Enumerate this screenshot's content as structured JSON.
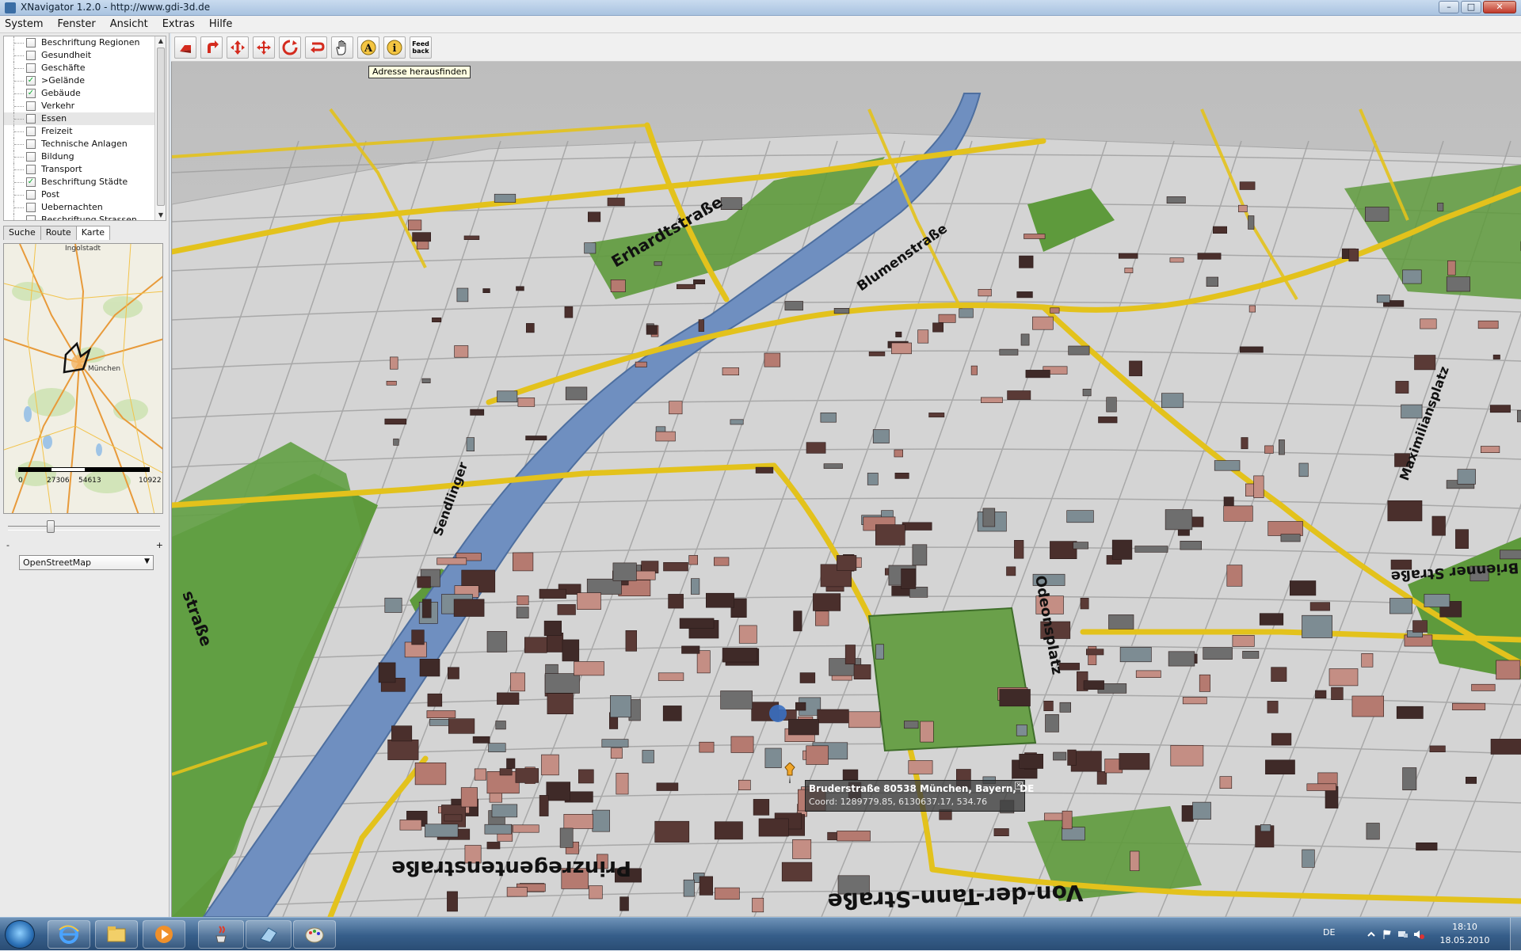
{
  "window": {
    "title": "XNavigator 1.2.0 - http://www.gdi-3d.de",
    "controls": [
      "–",
      "□",
      "✕"
    ]
  },
  "menu": [
    "System",
    "Fenster",
    "Ansicht",
    "Extras",
    "Hilfe"
  ],
  "layers": [
    {
      "label": "Beschriftung Regionen",
      "checked": false
    },
    {
      "label": "Gesundheit",
      "checked": false
    },
    {
      "label": "Geschäfte",
      "checked": false
    },
    {
      "label": ">Gelände",
      "checked": true
    },
    {
      "label": "Gebäude",
      "checked": true
    },
    {
      "label": "Verkehr",
      "checked": false
    },
    {
      "label": "Essen",
      "checked": false,
      "selected": true
    },
    {
      "label": "Freizeit",
      "checked": false
    },
    {
      "label": "Technische Anlagen",
      "checked": false
    },
    {
      "label": "Bildung",
      "checked": false
    },
    {
      "label": "Transport",
      "checked": false
    },
    {
      "label": "Beschriftung Städte",
      "checked": true
    },
    {
      "label": "Post",
      "checked": false
    },
    {
      "label": "Uebernachten",
      "checked": false
    },
    {
      "label": "Beschriftung Strassen",
      "checked": false
    }
  ],
  "tabs": [
    "Suche",
    "Route",
    "Karte"
  ],
  "active_tab": "Karte",
  "overview": {
    "city_top": "Ingolstadt",
    "city_main": "München",
    "scale_labels": [
      "0",
      "27306",
      "54613",
      "10922"
    ]
  },
  "zoom": {
    "minus": "-",
    "plus": "+",
    "level": 0.27
  },
  "map_source": "OpenStreetMap",
  "toolbar": {
    "buttons": [
      "rotate-left-icon",
      "rotate-right-icon",
      "move-vertical-icon",
      "move-pan-icon",
      "reset-view-icon",
      "undo-icon",
      "hand-icon",
      "annotate-icon",
      "info-icon",
      "feedback-icon"
    ],
    "feedback_label_1": "Feed",
    "feedback_label_2": "back",
    "annotate_glyph": "A",
    "info_glyph": "i"
  },
  "tooltip": "Adresse herausfinden",
  "street_labels": {
    "prinzregentenstrasse": "Prinzregentenstraße",
    "von_der_tann": "Von-der-Tann-Straße",
    "brienner": "Brienner Straße",
    "erhardtstrasse": "Erhardtstraße",
    "maximiliansplatz": "Maximiliansplatz",
    "odeonsplatz": "Odeonsplatz",
    "blumenstrasse": "Blumenstraße",
    "sendlinger": "Sendlinger",
    "strasse_left": "straße"
  },
  "popup": {
    "address": "Bruderstraße 80538 München, Bayern, DE",
    "coord": "Coord: 1289779.85, 6130637.17, 534.76"
  },
  "taskbar": {
    "apps": [
      "ie-icon",
      "explorer-icon",
      "mediaplayer-icon",
      "java-icon",
      "xnavigator-icon",
      "paint-icon"
    ],
    "lang": "DE",
    "time": "18:10",
    "date": "18.05.2010"
  },
  "colors": {
    "road_yellow": "#e3c21c",
    "river": "#6f8fc0",
    "park": "#5e9a3c",
    "building_dark": "#4a2f2c",
    "building_pink": "#b57a70",
    "ground": "#d9d9d9"
  }
}
